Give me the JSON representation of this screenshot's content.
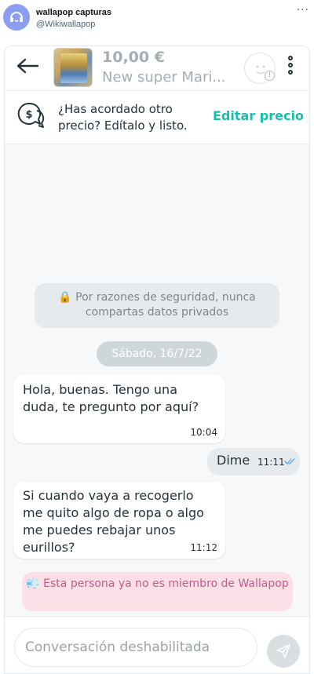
{
  "tweet": {
    "account_name": "wallapop capturas",
    "handle": "@Wikiwallapop",
    "more_label": "···"
  },
  "header": {
    "price": "10,00 €",
    "product_title": "New super Mari...",
    "seller_badge": "!"
  },
  "offer_bar": {
    "text": "¿Has acordado otro precio? Edítalo y listo.",
    "link_label": "Editar precio"
  },
  "security_notice": {
    "icon": "lock-icon",
    "text": "🔒 Por razones de seguridad, nunca compartas datos privados"
  },
  "date_chip": "Sábado, 16/7/22",
  "messages": [
    {
      "direction": "in",
      "text": "Hola, buenas. Tengo una duda, te pregunto por aquí?",
      "time": "10:04"
    },
    {
      "direction": "out",
      "text": "Dime",
      "time": "11:11",
      "status_icon": "double-check-icon"
    },
    {
      "direction": "in",
      "text": "Si cuando vaya a recogerlo me quito algo de ropa o algo me puedes rebajar unos eurillos?",
      "time": "11:12"
    }
  ],
  "left_notice": {
    "icon": "dash-icon",
    "text": "💨 Esta persona ya no es miembro de Wallapop"
  },
  "composer": {
    "placeholder": "Conversación deshabilitada"
  },
  "colors": {
    "accent": "#13c1ac",
    "notice_bg": "#e6eaec",
    "left_notice_bg": "#fde0e7",
    "left_notice_text": "#c45a86",
    "tick_blue": "#5aa9e6"
  }
}
